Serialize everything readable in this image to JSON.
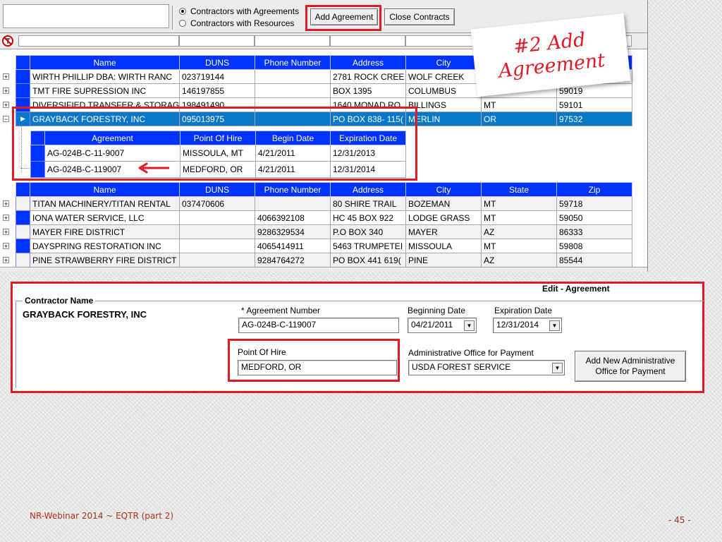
{
  "toolbar": {
    "radio_options": [
      "Contractors with Agreements",
      "Contractors with Resources"
    ],
    "add_agreement_label": "Add Agreement",
    "close_contracts_label": "Close Contracts"
  },
  "grid": {
    "columns": [
      "Name",
      "DUNS",
      "Phone Number",
      "Address",
      "City",
      "State",
      "Zip"
    ],
    "rows_top": [
      {
        "name": "WIRTH PHILLIP DBA: WIRTH RANC",
        "duns": "023719144",
        "phone": "",
        "address": "2781 ROCK CREE",
        "city": "WOLF CREEK",
        "state": "",
        "zip": ""
      },
      {
        "name": "TMT FIRE SUPRESSION INC",
        "duns": "146197855",
        "phone": "",
        "address": "BOX 1395",
        "city": "COLUMBUS",
        "state": "",
        "zip": "59019"
      },
      {
        "name": "DIVERSIFIED TRANSFER & STORAG",
        "duns": "198491490",
        "phone": "",
        "address": "1640 MONAD RO",
        "city": "BILLINGS",
        "state": "MT",
        "zip": "59101"
      }
    ],
    "selected_row": {
      "name": "GRAYBACK FORESTRY, INC",
      "duns": "095013975",
      "phone": "",
      "address": "PO BOX 838- 115(",
      "city": "MERLIN",
      "state": "OR",
      "zip": "97532"
    },
    "rows_bottom": [
      {
        "name": "TITAN MACHINERY/TITAN RENTAL",
        "duns": "037470606",
        "phone": "",
        "address": "80 SHIRE TRAIL",
        "city": "BOZEMAN",
        "state": "MT",
        "zip": "59718"
      },
      {
        "name": "IONA WATER SERVICE, LLC",
        "duns": "",
        "phone": "4066392108",
        "address": "HC 45 BOX 922",
        "city": "LODGE GRASS",
        "state": "MT",
        "zip": "59050"
      },
      {
        "name": "MAYER FIRE DISTRICT",
        "duns": "",
        "phone": "9286329534",
        "address": "P.O BOX 340",
        "city": "MAYER",
        "state": "AZ",
        "zip": "86333"
      },
      {
        "name": "DAYSPRING RESTORATION INC",
        "duns": "",
        "phone": "4065414911",
        "address": "5463 TRUMPETEI",
        "city": "MISSOULA",
        "state": "MT",
        "zip": "59808"
      },
      {
        "name": "PINE STRAWBERRY FIRE DISTRICT",
        "duns": "",
        "phone": "9284764272",
        "address": "PO BOX 441 619(",
        "city": "PINE",
        "state": "AZ",
        "zip": "85544"
      }
    ]
  },
  "agreements": {
    "columns": [
      "Agreement",
      "Point Of Hire",
      "Begin Date",
      "Expiration Date"
    ],
    "rows": [
      {
        "agreement": "AG-024B-C-11-9007",
        "point_of_hire": "MISSOULA, MT",
        "begin": "4/21/2011",
        "expiration": "12/31/2013"
      },
      {
        "agreement": "AG-024B-C-119007",
        "point_of_hire": "MEDFORD, OR",
        "begin": "4/21/2011",
        "expiration": "12/31/2014"
      }
    ]
  },
  "edit_panel": {
    "title": "Edit - Agreement",
    "contractor_label": "Contractor Name",
    "contractor_value": "GRAYBACK FORESTRY, INC",
    "agreement_number_label": "* Agreement Number",
    "agreement_number_value": "AG-024B-C-119007",
    "beginning_date_label": "Beginning Date",
    "beginning_date_value": "04/21/2011",
    "expiration_date_label": "Expiration Date",
    "expiration_date_value": "12/31/2014",
    "point_of_hire_label": "Point Of Hire",
    "point_of_hire_value": "MEDFORD, OR",
    "admin_office_label": "Administrative Office for Payment",
    "admin_office_value": "USDA FOREST SERVICE",
    "add_office_button": "Add New Administrative Office for Payment"
  },
  "annotation": {
    "line1": "#2 Add",
    "line2": "Agreement"
  },
  "footer": {
    "left": "NR-Webinar 2014 ~ EQTR (part 2)",
    "right": "- 45 -"
  },
  "colors": {
    "highlight": "#e01b24",
    "grid_header": "#0033ff",
    "selected_row": "#0a78c8"
  }
}
